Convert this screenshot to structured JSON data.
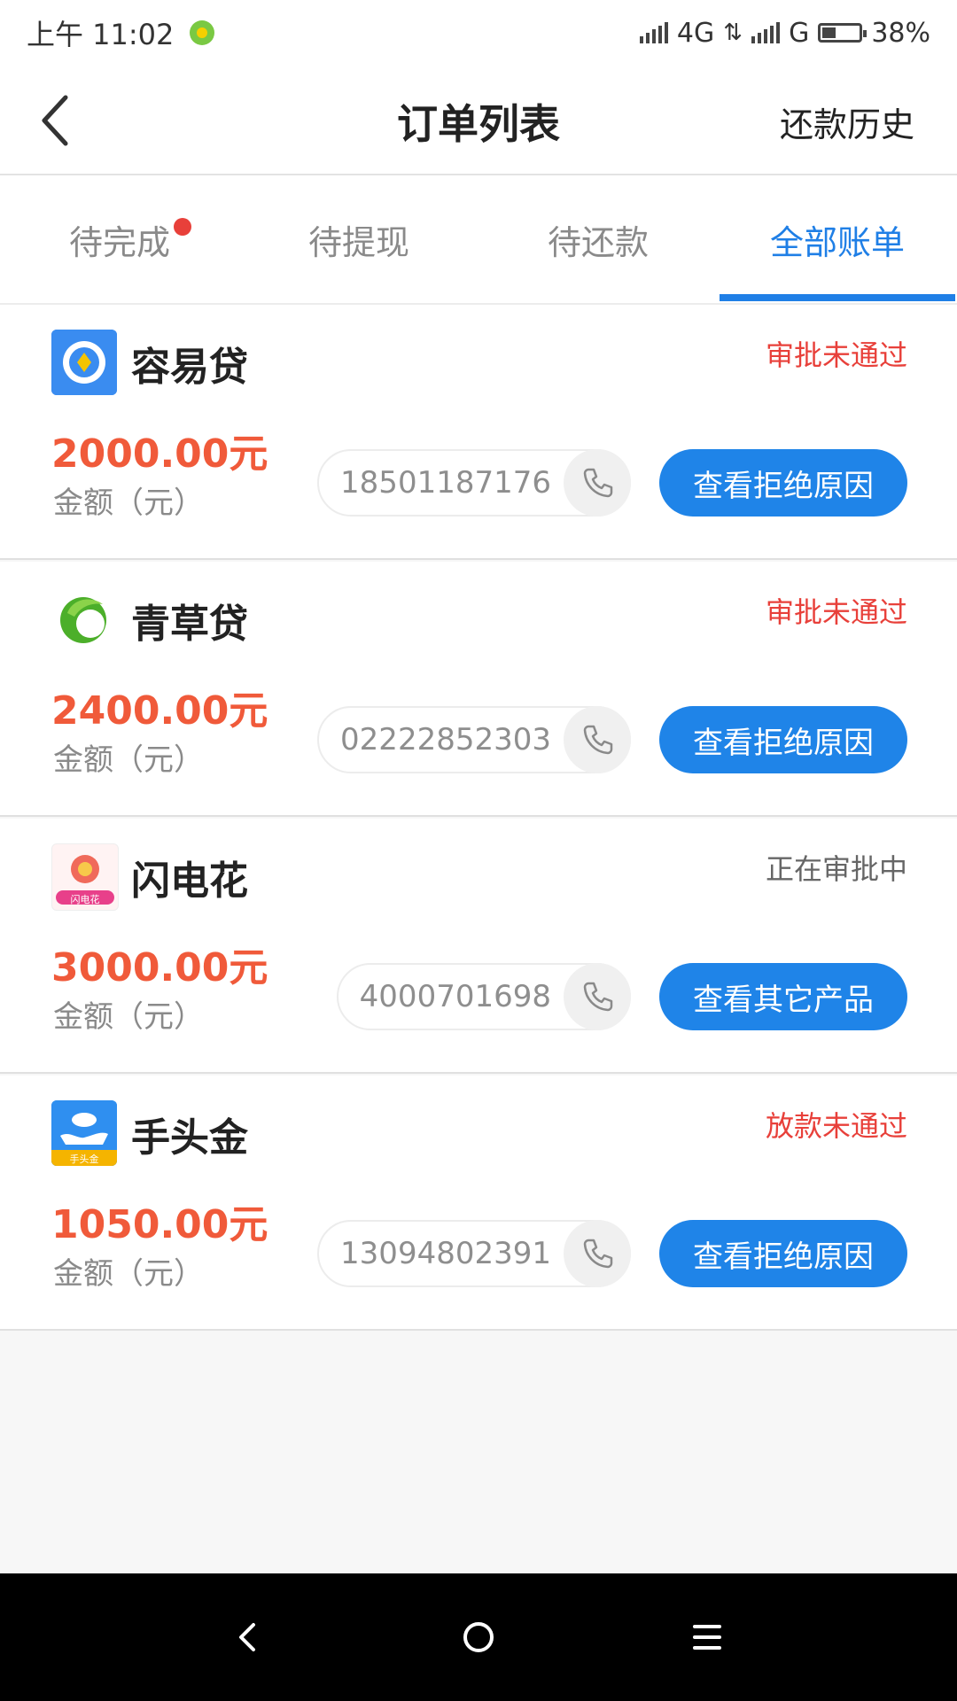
{
  "status_bar": {
    "time": "上午 11:02",
    "network1": "4G",
    "network2": "G",
    "battery_percent": "38%",
    "battery_level": 0.38
  },
  "header": {
    "title": "订单列表",
    "history_label": "还款历史"
  },
  "tabs": [
    {
      "label": "待完成",
      "has_dot": true
    },
    {
      "label": "待提现"
    },
    {
      "label": "待还款"
    },
    {
      "label": "全部账单",
      "active": true
    }
  ],
  "colors": {
    "accent": "#1f7fe6",
    "amount": "#f05a3a",
    "status_rejected": "#e8403a",
    "status_pending": "#666666"
  },
  "orders": [
    {
      "name": "容易贷",
      "logo_icon": "rongyidai-logo-icon",
      "status": "审批未通过",
      "amount": "2000.00元",
      "amount_label": "金额（元）",
      "phone": "18501187176",
      "action": "查看拒绝原因"
    },
    {
      "name": "青草贷",
      "logo_icon": "qingcaodai-logo-icon",
      "status": "审批未通过",
      "amount": "2400.00元",
      "amount_label": "金额（元）",
      "phone": "02222852303",
      "action": "查看拒绝原因"
    },
    {
      "name": "闪电花",
      "logo_icon": "shandianhua-logo-icon",
      "logo_text": "闪电花",
      "status": "正在审批中",
      "amount": "3000.00元",
      "amount_label": "金额（元）",
      "phone": "4000701698",
      "action": "查看其它产品"
    },
    {
      "name": "手头金",
      "logo_icon": "shoutoujin-logo-icon",
      "logo_text": "手头金",
      "status": "放款未通过",
      "amount": "1050.00元",
      "amount_label": "金额（元）",
      "phone": "13094802391",
      "action": "查看拒绝原因"
    }
  ]
}
